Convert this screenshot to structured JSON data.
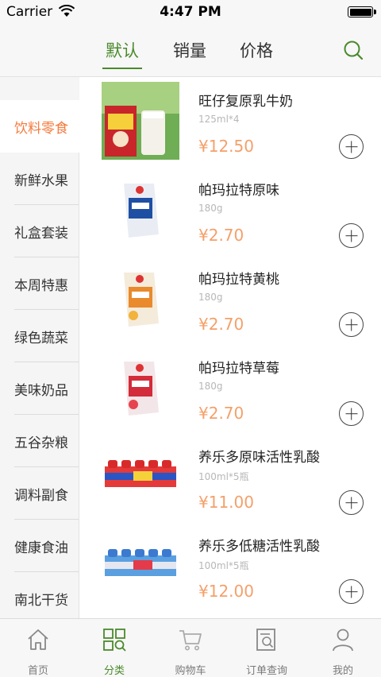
{
  "status_bar": {
    "carrier": "Carrier",
    "time": "4:47 PM"
  },
  "sort_tabs": [
    {
      "label": "默认",
      "active": true
    },
    {
      "label": "销量",
      "active": false
    },
    {
      "label": "价格",
      "active": false
    }
  ],
  "categories": [
    {
      "label": "饮料零食",
      "active": true
    },
    {
      "label": "新鲜水果"
    },
    {
      "label": "礼盒套装"
    },
    {
      "label": "本周特惠"
    },
    {
      "label": "绿色蔬菜"
    },
    {
      "label": "美味奶品"
    },
    {
      "label": "五谷杂粮"
    },
    {
      "label": "调料副食"
    },
    {
      "label": "健康食油"
    },
    {
      "label": "南北干货"
    }
  ],
  "products": [
    {
      "name": "旺仔复原乳牛奶",
      "spec": "125ml*4",
      "price": "¥12.50"
    },
    {
      "name": "帕玛拉特原味",
      "spec": "180g",
      "price": "¥2.70"
    },
    {
      "name": "帕玛拉特黄桃",
      "spec": "180g",
      "price": "¥2.70"
    },
    {
      "name": "帕玛拉特草莓",
      "spec": "180g",
      "price": "¥2.70"
    },
    {
      "name": "养乐多原味活性乳酸",
      "spec": "100ml*5瓶",
      "price": "¥11.00"
    },
    {
      "name": "养乐多低糖活性乳酸",
      "spec": "100ml*5瓶",
      "price": "¥12.00"
    }
  ],
  "tab_bar": [
    {
      "label": "首页",
      "icon": "home-icon"
    },
    {
      "label": "分类",
      "icon": "category-icon",
      "active": true
    },
    {
      "label": "购物车",
      "icon": "cart-icon"
    },
    {
      "label": "订单查询",
      "icon": "order-search-icon"
    },
    {
      "label": "我的",
      "icon": "user-icon"
    }
  ],
  "colors": {
    "accent": "#4a8a2c",
    "active_category": "#f47a3c",
    "price": "#f4a06a"
  }
}
